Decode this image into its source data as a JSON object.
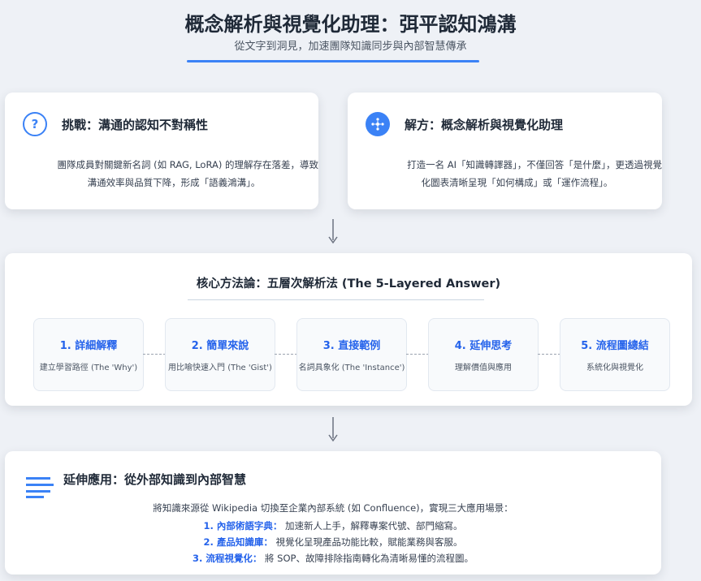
{
  "header": {
    "title": "概念解析與視覺化助理：弭平認知鴻溝",
    "subtitle": "從文字到洞見，加速團隊知識同步與內部智慧傳承"
  },
  "challenge": {
    "icon": "question-icon",
    "title": "挑戰：溝通的認知不對稱性",
    "body_line1": "團隊成員對關鍵新名詞 (如 RAG, LoRA) 的理解存在落差，導致",
    "body_line2": "溝通效率與品質下降，形成「語義鴻溝」。"
  },
  "solution": {
    "icon": "network-icon",
    "title": "解方：概念解析與視覺化助理",
    "body_line1": "打造一名 AI「知識轉譯器」，不僅回答「是什麼」，更透過視覺",
    "body_line2": "化圖表清晰呈現「如何構成」或「運作流程」。"
  },
  "method": {
    "title": "核心方法論：五層次解析法 (The 5-Layered Answer)",
    "layers": [
      {
        "title": "1. 詳細解釋",
        "desc": "建立學習路徑 (The 'Why')"
      },
      {
        "title": "2. 簡單來說",
        "desc": "用比喻快速入門 (The 'Gist')"
      },
      {
        "title": "3. 直接範例",
        "desc": "名詞具象化 (The 'Instance')"
      },
      {
        "title": "4. 延伸思考",
        "desc": "理解價值與應用"
      },
      {
        "title": "5. 流程圖總結",
        "desc": "系統化與視覺化"
      }
    ]
  },
  "extension": {
    "icon": "list-lines-icon",
    "title": "延伸應用：從外部知識到內部智慧",
    "intro": "將知識來源從 Wikipedia 切換至企業內部系統 (如 Confluence)，實現三大應用場景：",
    "items": [
      {
        "label": "1. 內部術語字典：",
        "text": "加速新人上手，解釋專案代號、部門縮寫。"
      },
      {
        "label": "2. 產品知識庫：",
        "text": "視覺化呈現產品功能比較，賦能業務與客服。"
      },
      {
        "label": "3. 流程視覺化：",
        "text": "將 SOP、故障排除指南轉化為清晰易懂的流程圖。"
      }
    ]
  },
  "colors": {
    "accent": "#3b82f6",
    "highlight": "#2563eb",
    "background": "#eef1f6"
  }
}
